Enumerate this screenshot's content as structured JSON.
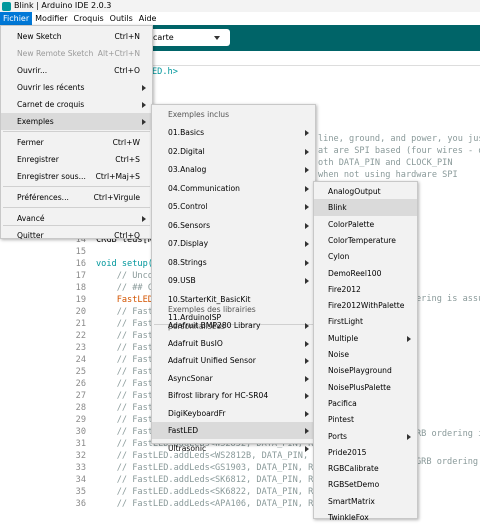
{
  "window": {
    "title": "Blink | Arduino IDE 2.0.3"
  },
  "menubar": {
    "items": [
      "Fichier",
      "Modifier",
      "Croquis",
      "Outils",
      "Aide"
    ]
  },
  "toolbar": {
    "board_select": "carte"
  },
  "editor": {
    "lines": [
      {
        "n": "",
        "text": "ED.h>",
        "cls": "or"
      },
      {
        "n": "",
        "text": "",
        "cls": ""
      },
      {
        "n": "14",
        "text": "CRGB leds[NUM_",
        "cls": ""
      },
      {
        "n": "15",
        "text": "",
        "cls": ""
      },
      {
        "n": "16",
        "text": "void setup() {",
        "cls": "kw"
      },
      {
        "n": "17",
        "text": "    // Uncomme",
        "cls": "cm"
      },
      {
        "n": "18",
        "text": "    // ## Clock",
        "cls": "cm"
      },
      {
        "n": "19",
        "text": "    FastLED.add",
        "cls": "or"
      },
      {
        "n": "20",
        "text": "    // FastLED.",
        "cls": "cm"
      },
      {
        "n": "21",
        "text": "    // FastLED.",
        "cls": "cm"
      },
      {
        "n": "22",
        "text": "    // FastLED.",
        "cls": "cm"
      },
      {
        "n": "23",
        "text": "    // FastLED.",
        "cls": "cm"
      },
      {
        "n": "24",
        "text": "    // FastLED.",
        "cls": "cm"
      },
      {
        "n": "25",
        "text": "    // FastLED.",
        "cls": "cm"
      },
      {
        "n": "26",
        "text": "    // FastLED.",
        "cls": "cm"
      },
      {
        "n": "27",
        "text": "    // FastLED.",
        "cls": "cm"
      },
      {
        "n": "28",
        "text": "    // FastLED.",
        "cls": "cm"
      },
      {
        "n": "29",
        "text": "    // FastLED.",
        "cls": "cm"
      },
      {
        "n": "30",
        "text": "    // FastLED.",
        "cls": "cm"
      },
      {
        "n": "31",
        "text": "    // FastLED.addLeds<WS2852, DATA_PIN, RGB>(l",
        "cls": "cm"
      },
      {
        "n": "32",
        "text": "    // FastLED.addLeds<WS2812B, DATA_PIN, RGB>(l",
        "cls": "cm"
      },
      {
        "n": "33",
        "text": "    // FastLED.addLeds<GS1903, DATA_PIN, RGB>(l",
        "cls": "cm"
      },
      {
        "n": "34",
        "text": "    // FastLED.addLeds<SK6812, DATA_PIN, RGB>(l",
        "cls": "cm"
      },
      {
        "n": "35",
        "text": "    // FastLED.addLeds<SK6822, DATA_PIN, RGB>(l",
        "cls": "cm"
      },
      {
        "n": "36",
        "text": "    // FastLED.addLeds<APA106, DATA_PIN, RGB>(l",
        "cls": "cm"
      }
    ],
    "fragments": [
      "line, ground, and power, you just",
      "at are SPI based (four wires - da",
      "oth DATA_PIN and CLOCK_PIN",
      "when not using hardware SPI",
      "gement.",
      "ering is assu",
      "RB ordering i",
      "GRB ordering",
      "RB ordering i",
      "RB ordering i"
    ]
  },
  "fichier_menu": {
    "items": [
      {
        "label": "New Sketch",
        "shortcut": "Ctrl+N"
      },
      {
        "label": "New Remote Sketch",
        "shortcut": "Alt+Ctrl+N",
        "disabled": true
      },
      {
        "label": "Ouvrir...",
        "shortcut": "Ctrl+O"
      },
      {
        "label": "Ouvrir les récents",
        "shortcut": ""
      },
      {
        "label": "Carnet de croquis",
        "shortcut": ""
      },
      {
        "label": "Exemples",
        "shortcut": ""
      },
      {
        "label": "Fermer",
        "shortcut": "Ctrl+W"
      },
      {
        "label": "Enregistrer",
        "shortcut": "Ctrl+S"
      },
      {
        "label": "Enregistrer sous...",
        "shortcut": "Ctrl+Maj+S"
      },
      {
        "label": "Préférences...",
        "shortcut": "Ctrl+Virgule"
      },
      {
        "label": "Avancé",
        "shortcut": ""
      },
      {
        "label": "Quitter",
        "shortcut": "Ctrl+Q"
      }
    ]
  },
  "examples_menu": {
    "header_builtin": "Exemples inclus",
    "builtin": [
      "01.Basics",
      "02.Digital",
      "03.Analog",
      "04.Communication",
      "05.Control",
      "06.Sensors",
      "07.Display",
      "08.Strings",
      "09.USB",
      "10.StarterKit_BasicKit",
      "11.ArduinoISP"
    ],
    "header_custom": "Exemples des librairies personnalisées",
    "custom": [
      "Adafruit BMP280 Library",
      "Adafruit BusIO",
      "Adafruit Unified Sensor",
      "AsyncSonar",
      "Bifrost library for HC-SR04",
      "DigiKeyboardFr",
      "FastLED",
      "Ultrasonic"
    ]
  },
  "fastled_menu": {
    "items": [
      "AnalogOutput",
      "Blink",
      "ColorPalette",
      "ColorTemperature",
      "Cylon",
      "DemoReel100",
      "Fire2012",
      "Fire2012WithPalette",
      "FirstLight",
      "Multiple",
      "Noise",
      "NoisePlayground",
      "NoisePlusPalette",
      "Pacifica",
      "Pintest",
      "Ports",
      "Pride2015",
      "RGBCalibrate",
      "RGBSetDemo",
      "SmartMatrix",
      "TwinkleFox"
    ]
  }
}
